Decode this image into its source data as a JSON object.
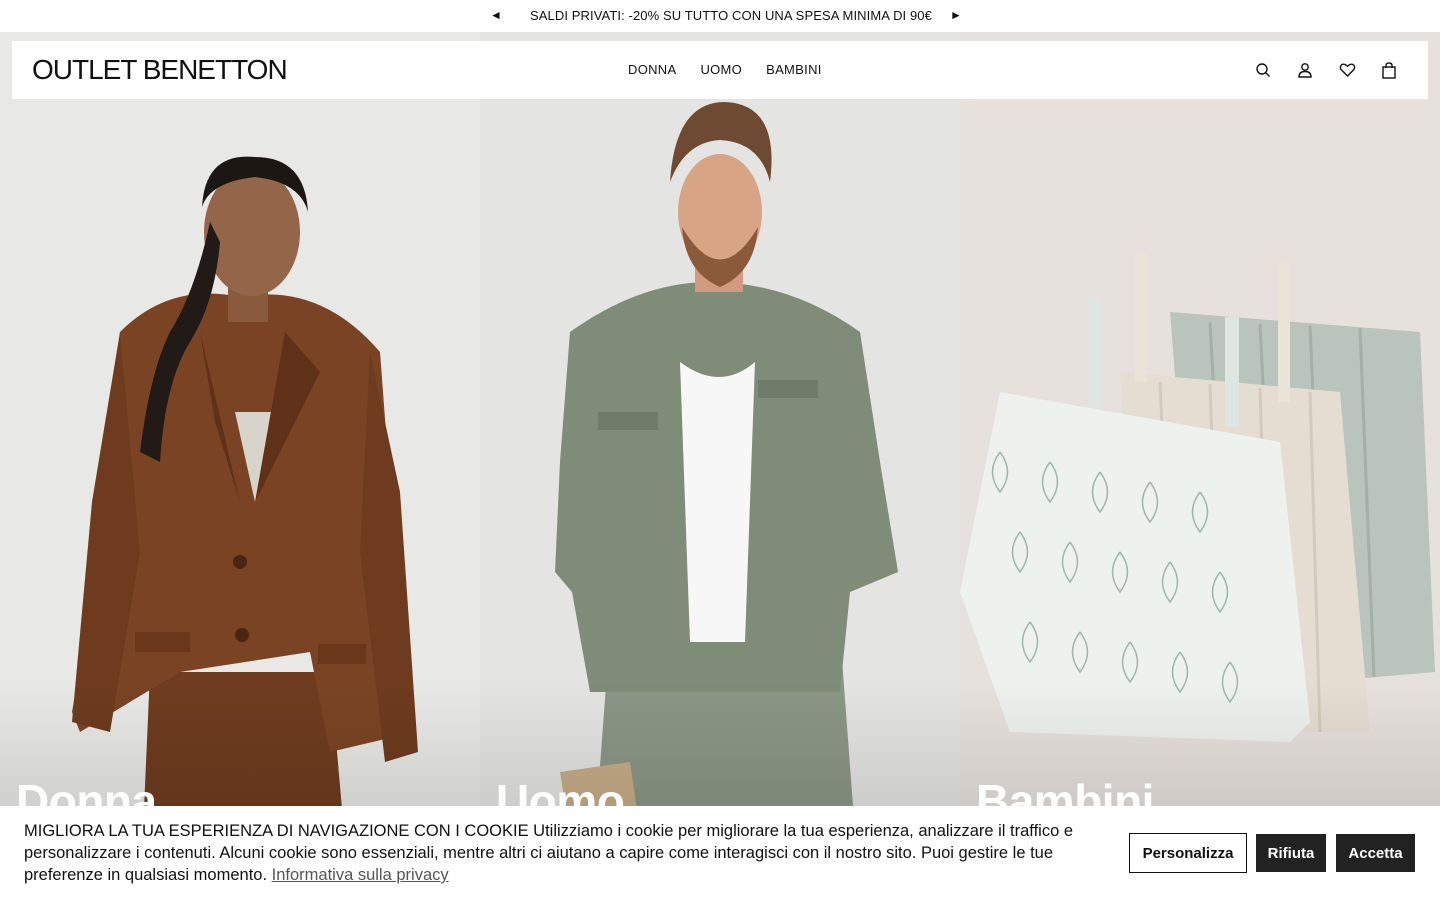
{
  "promo": {
    "prev_icon": "◄",
    "message": "SALDI PRIVATI: -20% SU TUTTO CON UNA SPESA MINIMA DI 90€",
    "next_icon": "►"
  },
  "header": {
    "logo": "OUTLET BENETTON",
    "nav": [
      "DONNA",
      "UOMO",
      "BAMBINI"
    ],
    "icons": [
      "search-icon",
      "account-icon",
      "wishlist-heart-icon",
      "shopping-bag-icon"
    ]
  },
  "hero": {
    "panels": [
      {
        "title": "Donna",
        "image": "woman-brown-linen-blazer"
      },
      {
        "title": "Uomo",
        "image": "man-green-shirt"
      },
      {
        "title": "Bambini",
        "image": "kids-sundresses"
      }
    ]
  },
  "cookie": {
    "text": "MIGLIORA LA TUA ESPERIENZA DI NAVIGAZIONE CON I COOKIE Utilizziamo i cookie per migliorare la tua esperienza, analizzare il traffico e personalizzare i contenuti. Alcuni cookie sono essenziali, mentre altri ci aiutano a capire come interagisci con il nostro sito. Puoi gestire le tue preferenze in qualsiasi momento.",
    "privacy_link": "Informativa sulla privacy",
    "buttons": {
      "customize": "Personalizza",
      "reject": "Rifiuta",
      "accept": "Accetta"
    }
  },
  "colors": {
    "dark_button": "#222222",
    "donna_blazer": "#7a4424",
    "uomo_shirt": "#7f8c78",
    "bambini_bg": "#e6e1dd"
  }
}
